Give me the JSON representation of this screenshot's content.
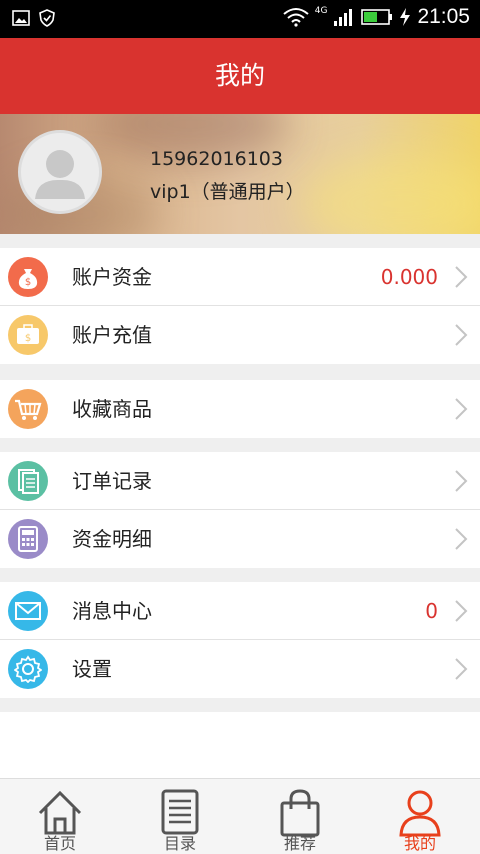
{
  "status_bar": {
    "time": "21:05",
    "network": "4G"
  },
  "header": {
    "title": "我的"
  },
  "profile": {
    "phone": "15962016103",
    "level": "vip1（普通用户）"
  },
  "groups": [
    [
      {
        "label": "账户资金",
        "value": "0.000",
        "icon": "money-bag-icon",
        "color": "#f26b4b"
      },
      {
        "label": "账户充值",
        "value": "",
        "icon": "wallet-icon",
        "color": "#f7c86a"
      }
    ],
    [
      {
        "label": "收藏商品",
        "value": "",
        "icon": "cart-icon",
        "color": "#f4a45c"
      }
    ],
    [
      {
        "label": "订单记录",
        "value": "",
        "icon": "document-icon",
        "color": "#5bc0a3"
      },
      {
        "label": "资金明细",
        "value": "",
        "icon": "calculator-icon",
        "color": "#9a8bc8"
      }
    ],
    [
      {
        "label": "消息中心",
        "value": "0",
        "icon": "envelope-icon",
        "color": "#36b8e8"
      },
      {
        "label": "设置",
        "value": "",
        "icon": "gear-icon",
        "color": "#36b8e8"
      }
    ]
  ],
  "tabs": [
    {
      "label": "首页",
      "icon": "home-icon",
      "active": false
    },
    {
      "label": "目录",
      "icon": "catalog-icon",
      "active": false
    },
    {
      "label": "推荐",
      "icon": "shopping-bag-icon",
      "active": false
    },
    {
      "label": "我的",
      "icon": "user-icon",
      "active": true
    }
  ],
  "colors": {
    "accent": "#d9332f",
    "active_tab": "#e8401c"
  }
}
